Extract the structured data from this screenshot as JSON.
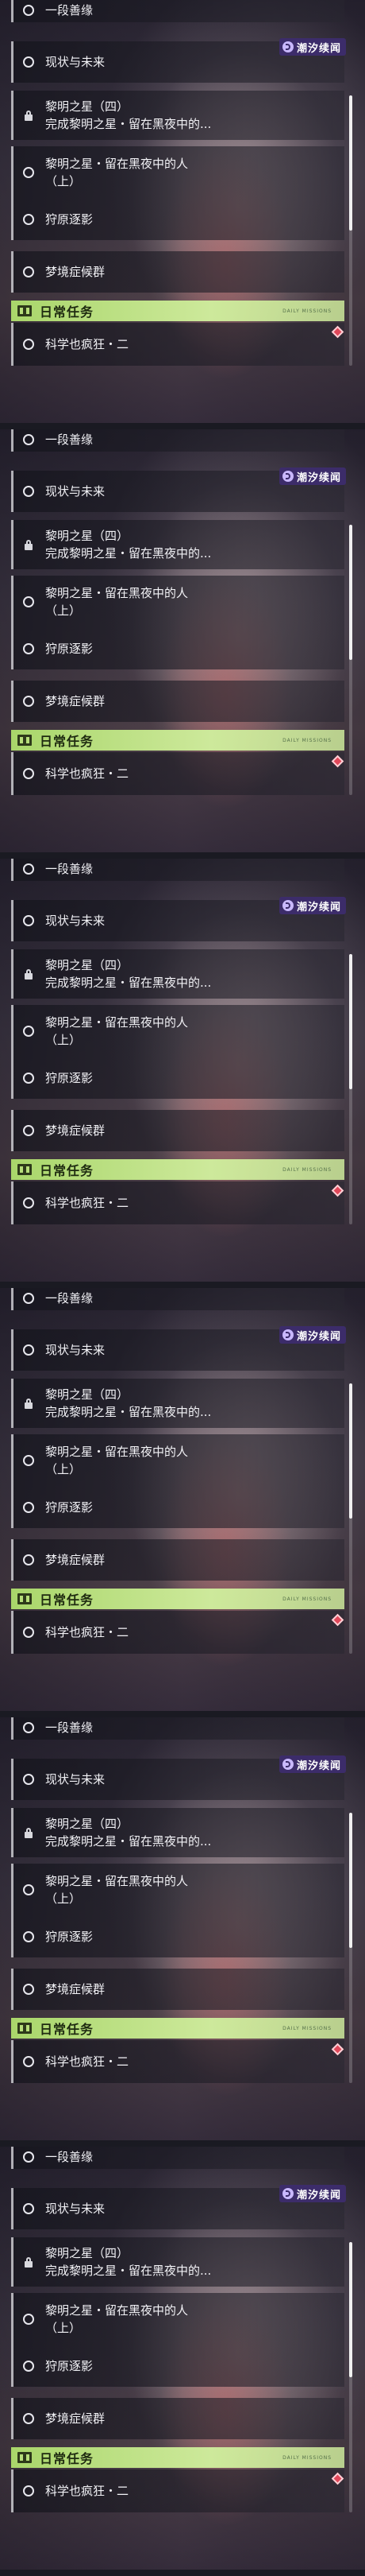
{
  "badge": {
    "icon": "wave-icon",
    "label": "潮汐续闻"
  },
  "quests": {
    "q0": "一段善缘",
    "q1": "现状与未来",
    "q2_title": "黎明之星（四）",
    "q2_sub": "完成黎明之星・留在黑夜中的...",
    "q3_line1": "黎明之星・留在黑夜中的人",
    "q3_line2": "（上）",
    "q4": "狩原逐影",
    "q5": "梦境症候群"
  },
  "daily": {
    "label": "日常任务",
    "small": "DAILY MISSIONS",
    "item": "科学也疯狂・二"
  },
  "colors": {
    "accent": "#a9d66a",
    "alert": "#ff4a4a",
    "badge_bg": "#3c2c6a"
  },
  "repeat_count": 6
}
